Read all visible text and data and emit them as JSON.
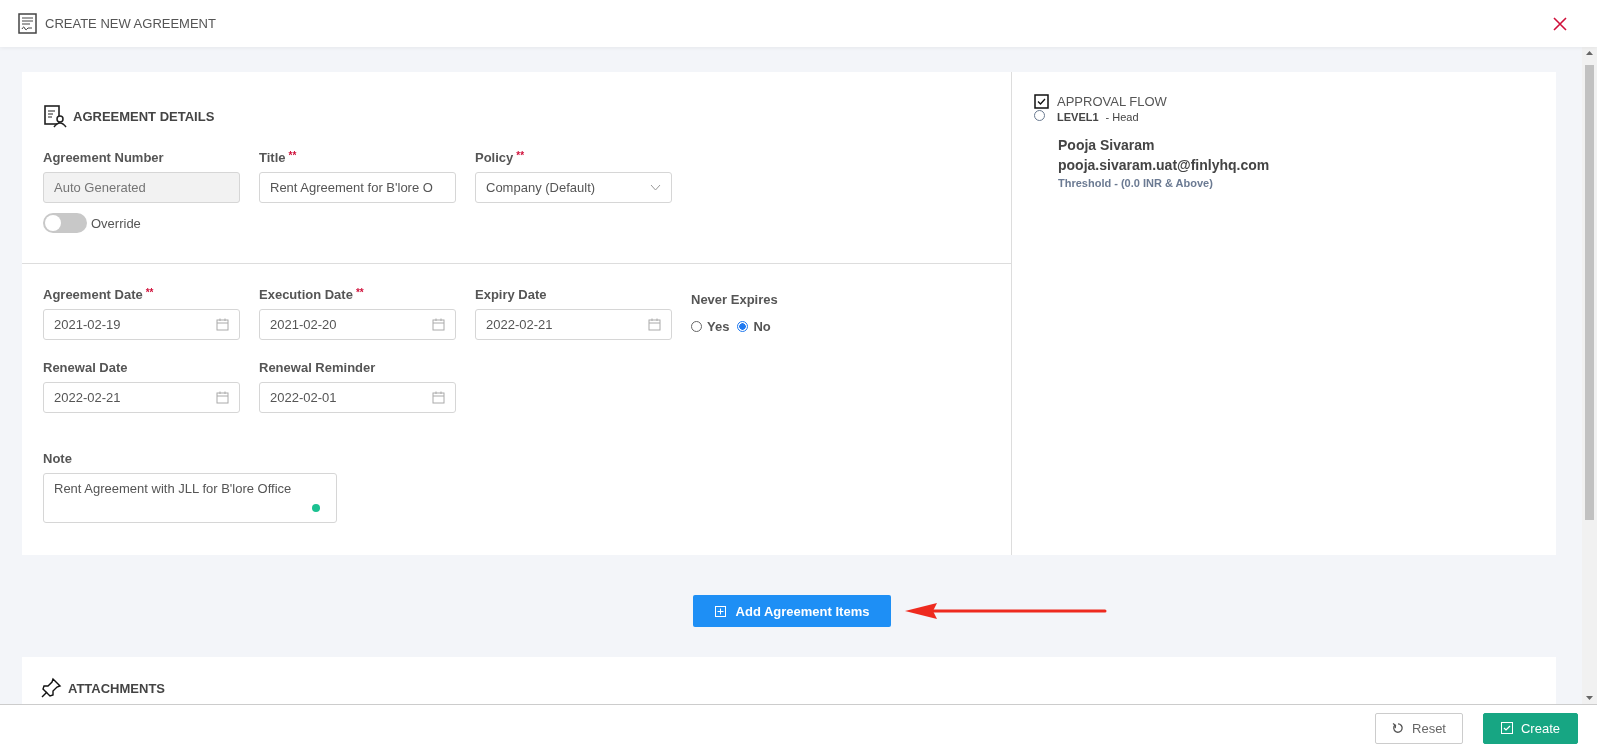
{
  "header": {
    "title": "CREATE NEW AGREEMENT"
  },
  "agreement_details": {
    "title": "AGREEMENT DETAILS",
    "agreement_number": {
      "label": "Agreement Number",
      "placeholder": "Auto Generated",
      "disabled": true
    },
    "override": {
      "label": "Override",
      "on": false
    },
    "title_field": {
      "label": "Title",
      "required_mark": "**",
      "value": "Rent Agreement for B'lore O"
    },
    "policy": {
      "label": "Policy",
      "required_mark": "**",
      "value": "Company (Default)"
    },
    "dates": [
      {
        "label": "Agreement Date",
        "required_mark": "**",
        "value": "2021-02-19"
      },
      {
        "label": "Execution Date",
        "required_mark": "**",
        "value": "2021-02-20"
      },
      {
        "label": "Expiry Date",
        "value": "2022-02-21"
      }
    ],
    "never_expires": {
      "label": "Never Expires",
      "options": [
        {
          "label": "Yes",
          "selected": false
        },
        {
          "label": "No",
          "selected": true
        }
      ]
    },
    "renewal": [
      {
        "label": "Renewal Date",
        "value": "2022-02-21"
      },
      {
        "label": "Renewal Reminder",
        "value": "2022-02-01"
      }
    ],
    "note": {
      "label": "Note",
      "value": "Rent Agreement with JLL for B'lore Office"
    }
  },
  "approval_flow": {
    "title": "APPROVAL FLOW",
    "checked": true,
    "levels": [
      {
        "level": "LEVEL1",
        "role": "-  Head",
        "selected": false,
        "name": "Pooja Sivaram",
        "email": "pooja.sivaram.uat@finlyhq.com",
        "threshold": "Threshold -  (0.0 INR & Above)"
      }
    ]
  },
  "add_items_button": "Add Agreement Items",
  "attachments": {
    "title": "ATTACHMENTS"
  },
  "footer": {
    "buttons": [
      {
        "label": "Reset",
        "kind": "secondary"
      },
      {
        "label": "Create",
        "kind": "primary"
      }
    ]
  }
}
